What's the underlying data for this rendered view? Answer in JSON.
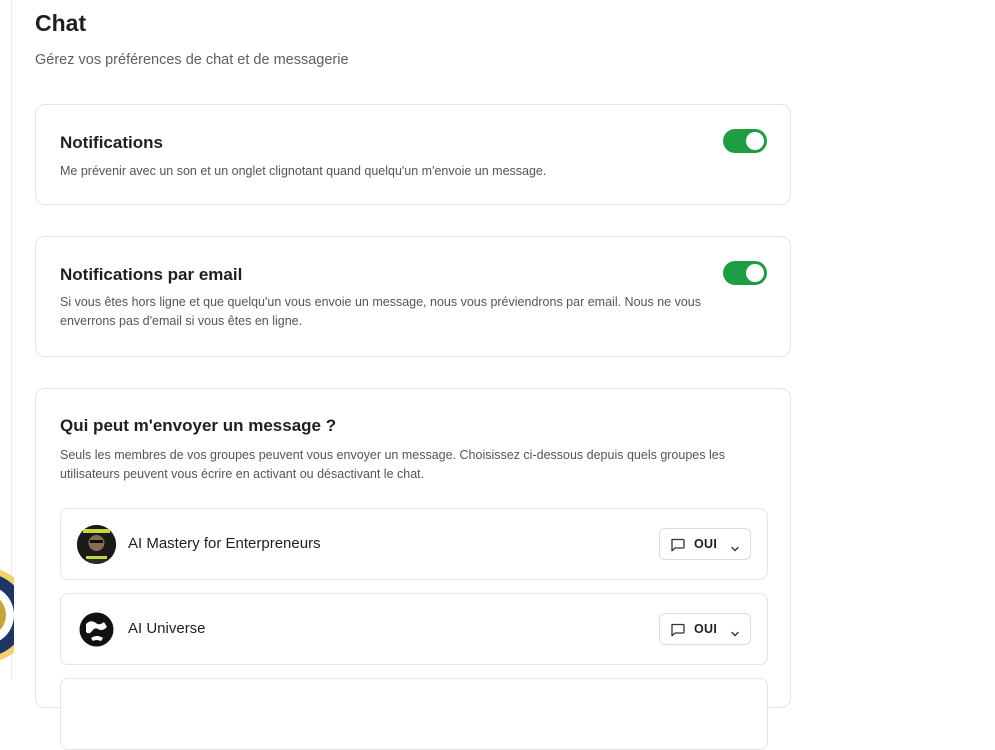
{
  "page": {
    "title": "Chat",
    "subtitle": "Gérez vos préférences de chat et de messagerie"
  },
  "settings": [
    {
      "title": "Notifications",
      "description": "Me prévenir avec un son et un onglet clignotant quand quelqu'un m'envoie un message.",
      "enabled": true
    },
    {
      "title": "Notifications par email",
      "description": "Si vous êtes hors ligne et que quelqu'un vous envoie un message, nous vous préviendrons par email. Nous ne vous enverrons pas d'email si vous êtes en ligne.",
      "enabled": true
    }
  ],
  "who_can_message": {
    "title": "Qui peut m'envoyer un message ?",
    "description": "Seuls les membres de vos groupes peuvent vous envoyer un message. Choisissez ci-dessous depuis quels groupes les utilisateurs peuvent vous écrire en activant ou désactivant le chat.",
    "groups": [
      {
        "name": "AI Mastery for Enterpreneurs",
        "chat_value": "OUI",
        "icon": "chat-bubble-icon"
      },
      {
        "name": "AI Universe",
        "chat_value": "OUI",
        "icon": "chat-bubble-icon"
      }
    ]
  },
  "colors": {
    "toggle_on": "#1f9d45",
    "border": "#e5e5e5",
    "text_muted": "#555555"
  }
}
